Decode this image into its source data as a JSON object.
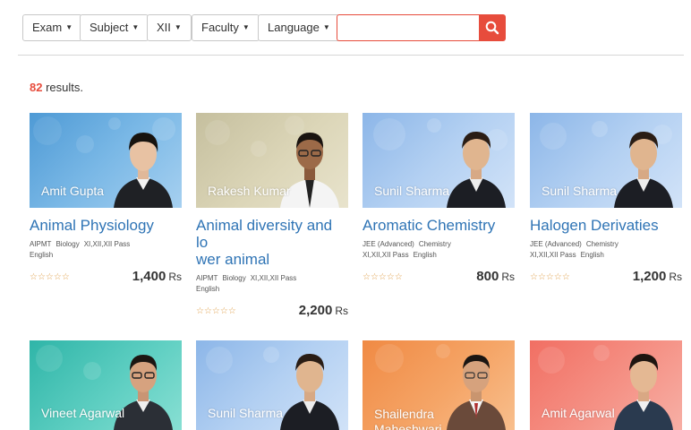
{
  "filters": {
    "exam": "Exam",
    "subject": "Subject",
    "class": "XII",
    "faculty": "Faculty",
    "language": "Language"
  },
  "search": {
    "value": "",
    "placeholder": ""
  },
  "results": {
    "count": "82",
    "label": " results."
  },
  "cards": [
    {
      "teacher": "Amit Gupta",
      "title": "Animal Physiology",
      "exam": "AIPMT",
      "subject": "Biology",
      "classes": "XI,XII,XII Pass",
      "language": "English",
      "rating": 0,
      "price": "1,400",
      "currency": "Rs",
      "color": "#4e9ad5"
    },
    {
      "teacher": "Rakesh Kumar",
      "title": "Animal diversity and lo wer animal",
      "title_line1": "Animal diversity and lo",
      "title_line2": "wer animal",
      "exam": "AIPMT",
      "subject": "Biology",
      "classes": "XI,XII,XII Pass",
      "language": "English",
      "rating": 0,
      "price": "2,200",
      "currency": "Rs",
      "color": "#c5bf9e"
    },
    {
      "teacher": "Sunil Sharma",
      "title": "Aromatic Chemistry",
      "exam": "JEE (Advanced)",
      "subject": "Chemistry",
      "classes": "XI,XII,XII Pass",
      "language": "English",
      "rating": 0,
      "price": "800",
      "currency": "Rs",
      "color": "#8cb6e8"
    },
    {
      "teacher": "Sunil Sharma",
      "title": "Halogen Derivaties",
      "exam": "JEE (Advanced)",
      "subject": "Chemistry",
      "classes": "XI,XII,XII Pass",
      "language": "English",
      "rating": 0,
      "price": "1,200",
      "currency": "Rs",
      "color": "#8cb6e8"
    },
    {
      "teacher": "Vineet Agarwal",
      "color": "#2fb5a8"
    },
    {
      "teacher": "Sunil Sharma",
      "color": "#8cb6e8"
    },
    {
      "teacher": "Shailendra Maheshwari",
      "color": "#f08a44"
    },
    {
      "teacher": "Amit Agarwal",
      "color": "#f16f63"
    }
  ],
  "icons": {
    "search": "search-icon",
    "caret": "caret-down-icon",
    "star": "star-outline-icon"
  },
  "colors": {
    "accent": "#e74c3c",
    "link": "#2f74b5",
    "star": "#e0a04c"
  }
}
